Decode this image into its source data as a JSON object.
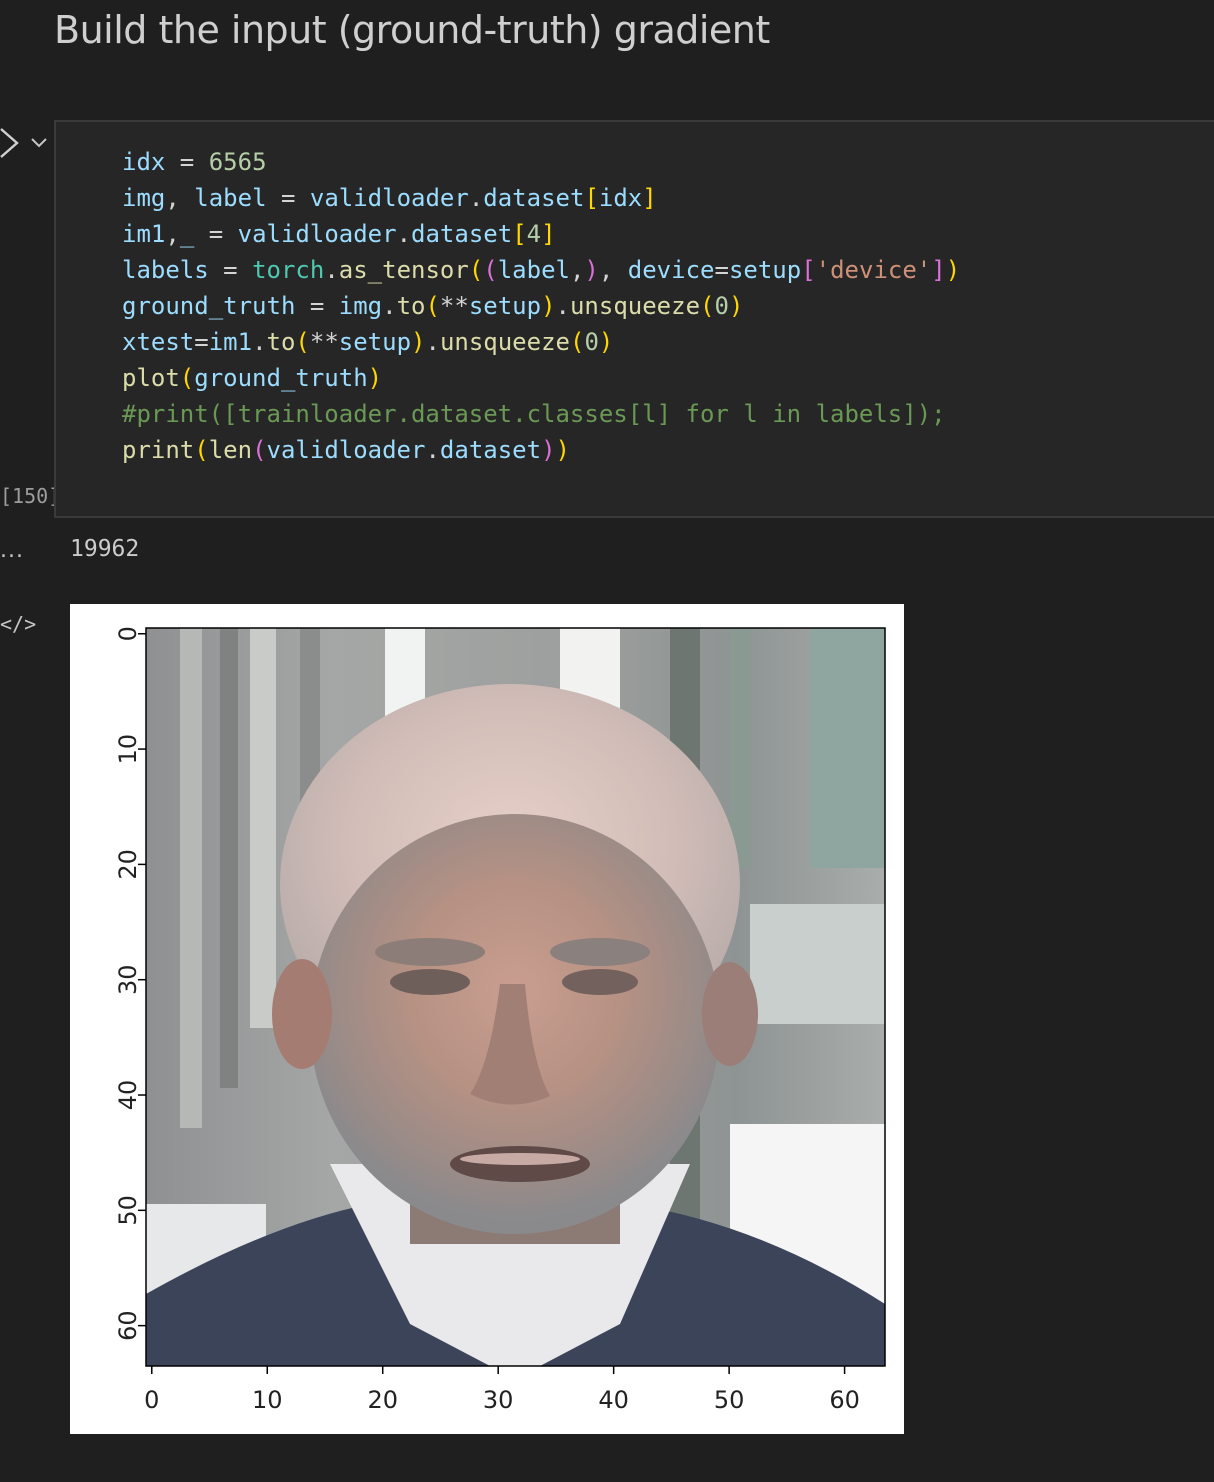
{
  "heading": "Build the input (ground-truth) gradient",
  "cell": {
    "execution_count": "[150]",
    "code_lines": [
      "idx = 6565",
      "img, label = validloader.dataset[idx]",
      "im1,_ = validloader.dataset[4]",
      "labels = torch.as_tensor((label,), device=setup['device'])",
      "ground_truth = img.to(**setup).unsqueeze(0)",
      "xtest=im1.to(**setup).unsqueeze(0)",
      "plot(ground_truth)",
      "#print([trainloader.dataset.classes[l] for l in labels]);",
      "print(len(validloader.dataset))"
    ],
    "run_icon": "run-arrow-icon",
    "collapse_icon": "chevron-down-icon"
  },
  "output": {
    "ellipsis": "...",
    "stdout": "19962",
    "image_output_icon": "code-brackets-icon",
    "image_output_label": "</>"
  },
  "chart_data": {
    "type": "heatmap",
    "xlim": [
      -0.5,
      63.5
    ],
    "ylim": [
      63.5,
      -0.5
    ],
    "x_ticks": [
      0,
      10,
      20,
      30,
      40,
      50,
      60
    ],
    "y_ticks": [
      0,
      10,
      20,
      30,
      40,
      50,
      60
    ],
    "x_tick_labels": [
      "0",
      "10",
      "20",
      "30",
      "40",
      "50",
      "60"
    ],
    "y_tick_labels": [
      "0",
      "10",
      "20",
      "30",
      "40",
      "50",
      "60"
    ],
    "y_tick_rotation": "vertical",
    "grid": false,
    "content": "64x64 RGB photo of an older man's face"
  }
}
